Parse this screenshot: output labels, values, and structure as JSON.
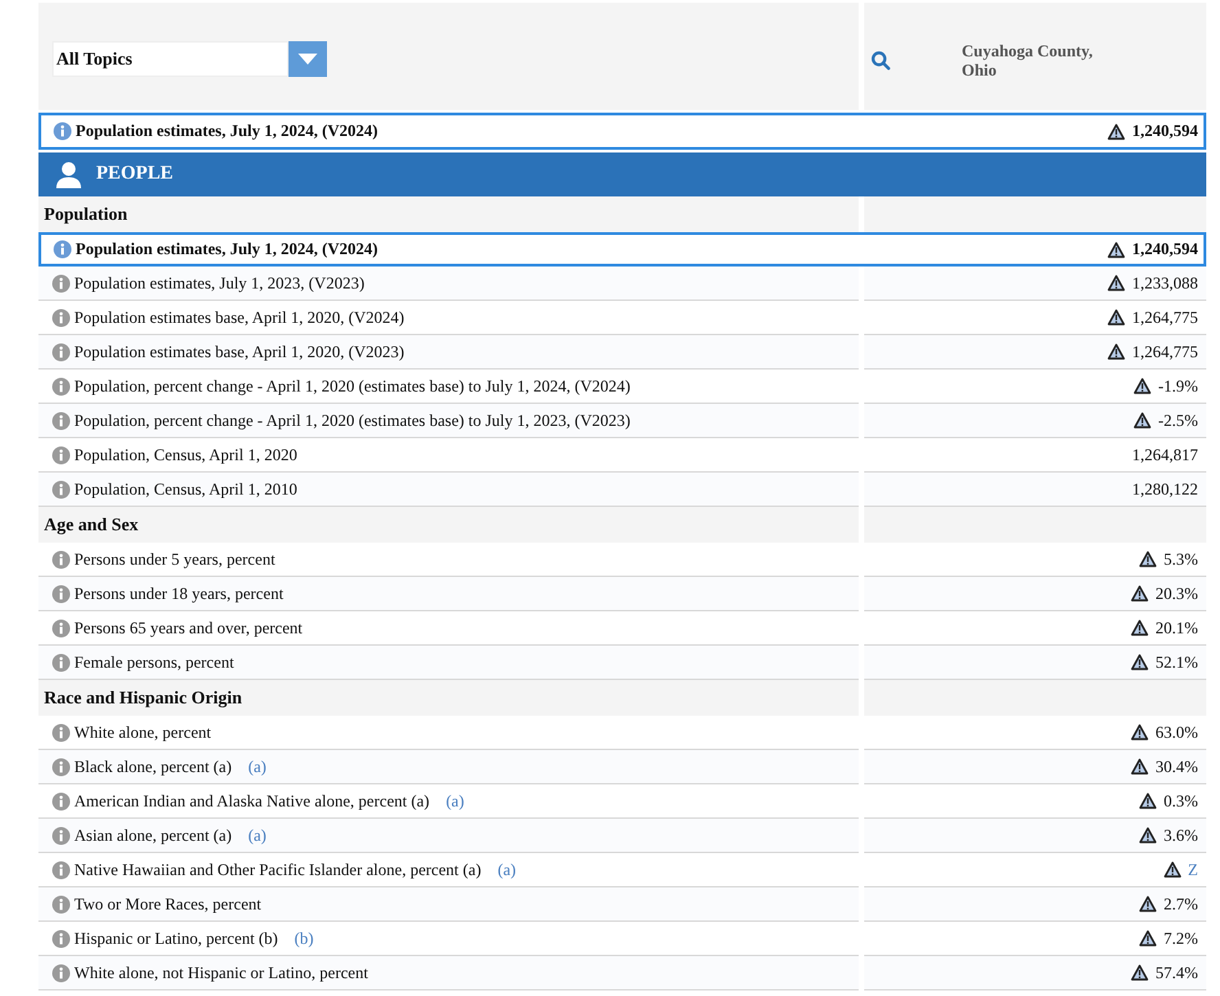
{
  "topic_select": {
    "value": "All Topics"
  },
  "geography": "Cuyahoga County, Ohio",
  "pinned_row": {
    "label": "Population estimates, July 1, 2024, (V2024)",
    "value": "1,240,594",
    "flagged": true
  },
  "category": {
    "label": "PEOPLE"
  },
  "sections": [
    {
      "title": "Population",
      "rows": [
        {
          "label": "Population estimates, July 1, 2024, (V2024)",
          "value": "1,240,594",
          "flagged": true,
          "selected": true,
          "value_link": false
        },
        {
          "label": "Population estimates, July 1, 2023, (V2023)",
          "value": "1,233,088",
          "flagged": true,
          "selected": false,
          "value_link": false
        },
        {
          "label": "Population estimates base, April 1, 2020, (V2024)",
          "value": "1,264,775",
          "flagged": true,
          "selected": false,
          "value_link": false
        },
        {
          "label": "Population estimates base, April 1, 2020, (V2023)",
          "value": "1,264,775",
          "flagged": true,
          "selected": false,
          "value_link": false
        },
        {
          "label": "Population, percent change - April 1, 2020 (estimates base) to July 1, 2024, (V2024)",
          "value": "-1.9%",
          "flagged": true,
          "selected": false,
          "value_link": false
        },
        {
          "label": "Population, percent change - April 1, 2020 (estimates base) to July 1, 2023, (V2023)",
          "value": "-2.5%",
          "flagged": true,
          "selected": false,
          "value_link": false
        },
        {
          "label": "Population, Census, April 1, 2020",
          "value": "1,264,817",
          "flagged": false,
          "selected": false,
          "value_link": false
        },
        {
          "label": "Population, Census, April 1, 2010",
          "value": "1,280,122",
          "flagged": false,
          "selected": false,
          "value_link": false
        }
      ]
    },
    {
      "title": "Age and Sex",
      "rows": [
        {
          "label": "Persons under 5 years, percent",
          "value": "5.3%",
          "flagged": true,
          "selected": false,
          "value_link": false
        },
        {
          "label": "Persons under 18 years, percent",
          "value": "20.3%",
          "flagged": true,
          "selected": false,
          "value_link": false
        },
        {
          "label": "Persons 65 years and over, percent",
          "value": "20.1%",
          "flagged": true,
          "selected": false,
          "value_link": false
        },
        {
          "label": "Female persons, percent",
          "value": "52.1%",
          "flagged": true,
          "selected": false,
          "value_link": false
        }
      ]
    },
    {
      "title": "Race and Hispanic Origin",
      "rows": [
        {
          "label": "White alone, percent",
          "value": "63.0%",
          "flagged": true,
          "selected": false,
          "value_link": false
        },
        {
          "label": "Black alone, percent (a)",
          "footnote": "(a)",
          "value": "30.4%",
          "flagged": true,
          "selected": false,
          "value_link": false
        },
        {
          "label": "American Indian and Alaska Native alone, percent (a)",
          "footnote": "(a)",
          "value": "0.3%",
          "flagged": true,
          "selected": false,
          "value_link": false
        },
        {
          "label": "Asian alone, percent (a)",
          "footnote": "(a)",
          "value": "3.6%",
          "flagged": true,
          "selected": false,
          "value_link": false
        },
        {
          "label": "Native Hawaiian and Other Pacific Islander alone, percent (a)",
          "footnote": "(a)",
          "value": "Z",
          "flagged": true,
          "selected": false,
          "value_link": true
        },
        {
          "label": "Two or More Races, percent",
          "value": "2.7%",
          "flagged": true,
          "selected": false,
          "value_link": false
        },
        {
          "label": "Hispanic or Latino, percent (b)",
          "footnote": "(b)",
          "value": "7.2%",
          "flagged": true,
          "selected": false,
          "value_link": false
        },
        {
          "label": "White alone, not Hispanic or Latino, percent",
          "value": "57.4%",
          "flagged": true,
          "selected": false,
          "value_link": false
        }
      ]
    }
  ]
}
